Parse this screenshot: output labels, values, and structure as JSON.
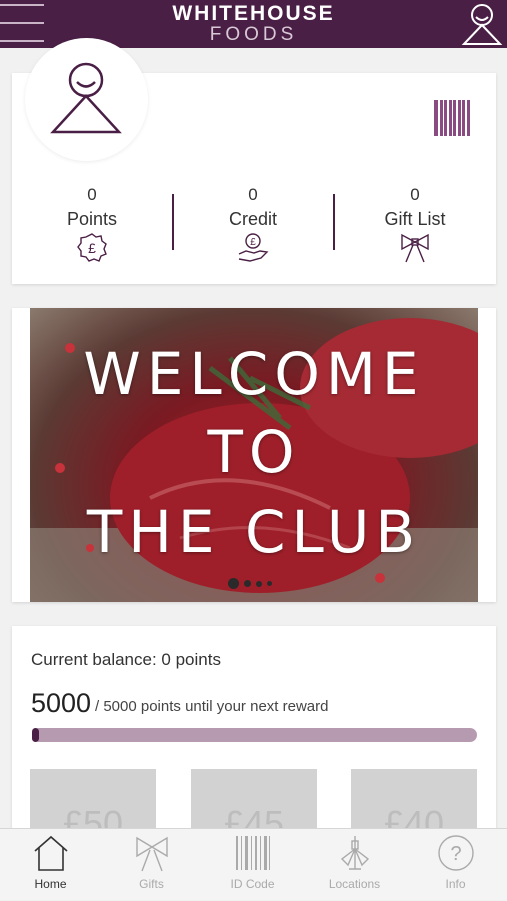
{
  "header": {
    "brand_line1": "WHITEHOUSE",
    "brand_line2": "FOODS"
  },
  "stats": [
    {
      "value": "0",
      "label": "Points",
      "icon": "pound-badge-icon"
    },
    {
      "value": "0",
      "label": "Credit",
      "icon": "pound-hand-icon"
    },
    {
      "value": "0",
      "label": "Gift List",
      "icon": "bow-icon"
    }
  ],
  "banner": {
    "line1": "WELCOME",
    "line2": "TO",
    "line3": "THE CLUB",
    "slide_count": 4,
    "active_slide": 1
  },
  "balance": {
    "label": "Current balance: 0 points",
    "remaining": "5000",
    "remaining_text": "/ 5000 points until your next reward",
    "progress_fraction": 0.01
  },
  "vouchers": [
    "£50",
    "£45",
    "£40"
  ],
  "tabs": [
    {
      "label": "Home",
      "icon": "home-icon",
      "active": true
    },
    {
      "label": "Gifts",
      "icon": "bow-icon",
      "active": false
    },
    {
      "label": "ID Code",
      "icon": "barcode-icon",
      "active": false
    },
    {
      "label": "Locations",
      "icon": "locations-icon",
      "active": false
    },
    {
      "label": "Info",
      "icon": "info-icon",
      "active": false
    }
  ],
  "colors": {
    "brand": "#4a1f45",
    "accent": "#8a4a82",
    "progress_track": "#b69bb0"
  }
}
